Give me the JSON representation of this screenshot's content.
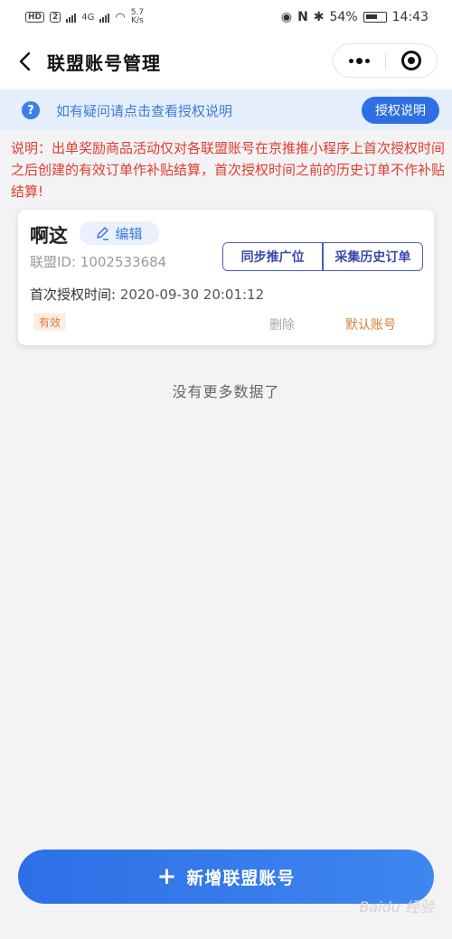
{
  "status_bar": {
    "hd_label": "HD",
    "sim2_label": "2",
    "network": "4G",
    "speed_value": "5.7",
    "speed_unit": "K/s",
    "battery": "54%",
    "time": "14:43"
  },
  "nav": {
    "title": "联盟账号管理"
  },
  "notice": {
    "text": "如有疑问请点击查看授权说明",
    "button_label": "授权说明"
  },
  "disclaimer": "说明：出单奖励商品活动仅对各联盟账号在京推推小程序上首次授权时间之后创建的有效订单作补贴结算，首次授权时间之前的历史订单不作补贴结算!",
  "account": {
    "name": "啊这",
    "edit_label": "编辑",
    "union_id": "联盟ID: 1002533684",
    "sync_label": "同步推广位",
    "collect_label": "采集历史订单",
    "auth_time_label": "首次授权时间: ",
    "auth_time_value": "2020-09-30 20:01:12",
    "status": "有效",
    "delete_label": "删除",
    "default_label": "默认账号"
  },
  "list_end_text": "没有更多数据了",
  "add_button": {
    "icon": "+",
    "label": "新增联盟账号"
  },
  "watermark": "Baidu 经验",
  "colors": {
    "primary": "#2f6fe4",
    "warning_red": "#e33b2e",
    "accent_orange": "#d2813a"
  }
}
